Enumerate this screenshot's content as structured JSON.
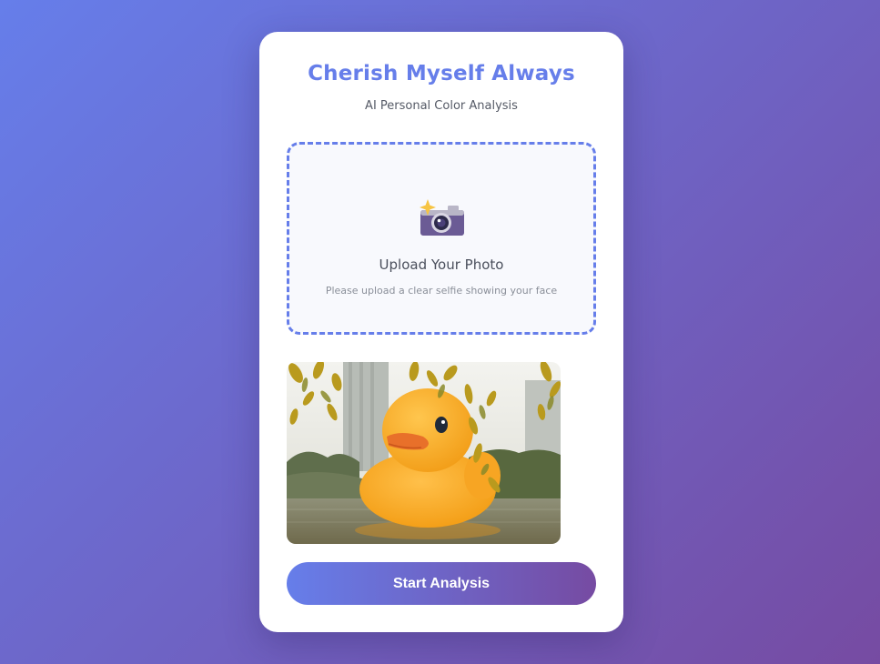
{
  "header": {
    "title": "Cherish Myself Always",
    "subtitle": "AI Personal Color Analysis"
  },
  "upload": {
    "icon": "camera-flash-icon",
    "title": "Upload Your Photo",
    "hint": "Please upload a clear selfie showing your face"
  },
  "preview": {
    "alt": "uploaded photo preview"
  },
  "actions": {
    "start_label": "Start Analysis"
  },
  "colors": {
    "accent": "#667eea",
    "accent_end": "#764ba2",
    "card": "#ffffff",
    "upload_bg": "#f8f9fd"
  }
}
